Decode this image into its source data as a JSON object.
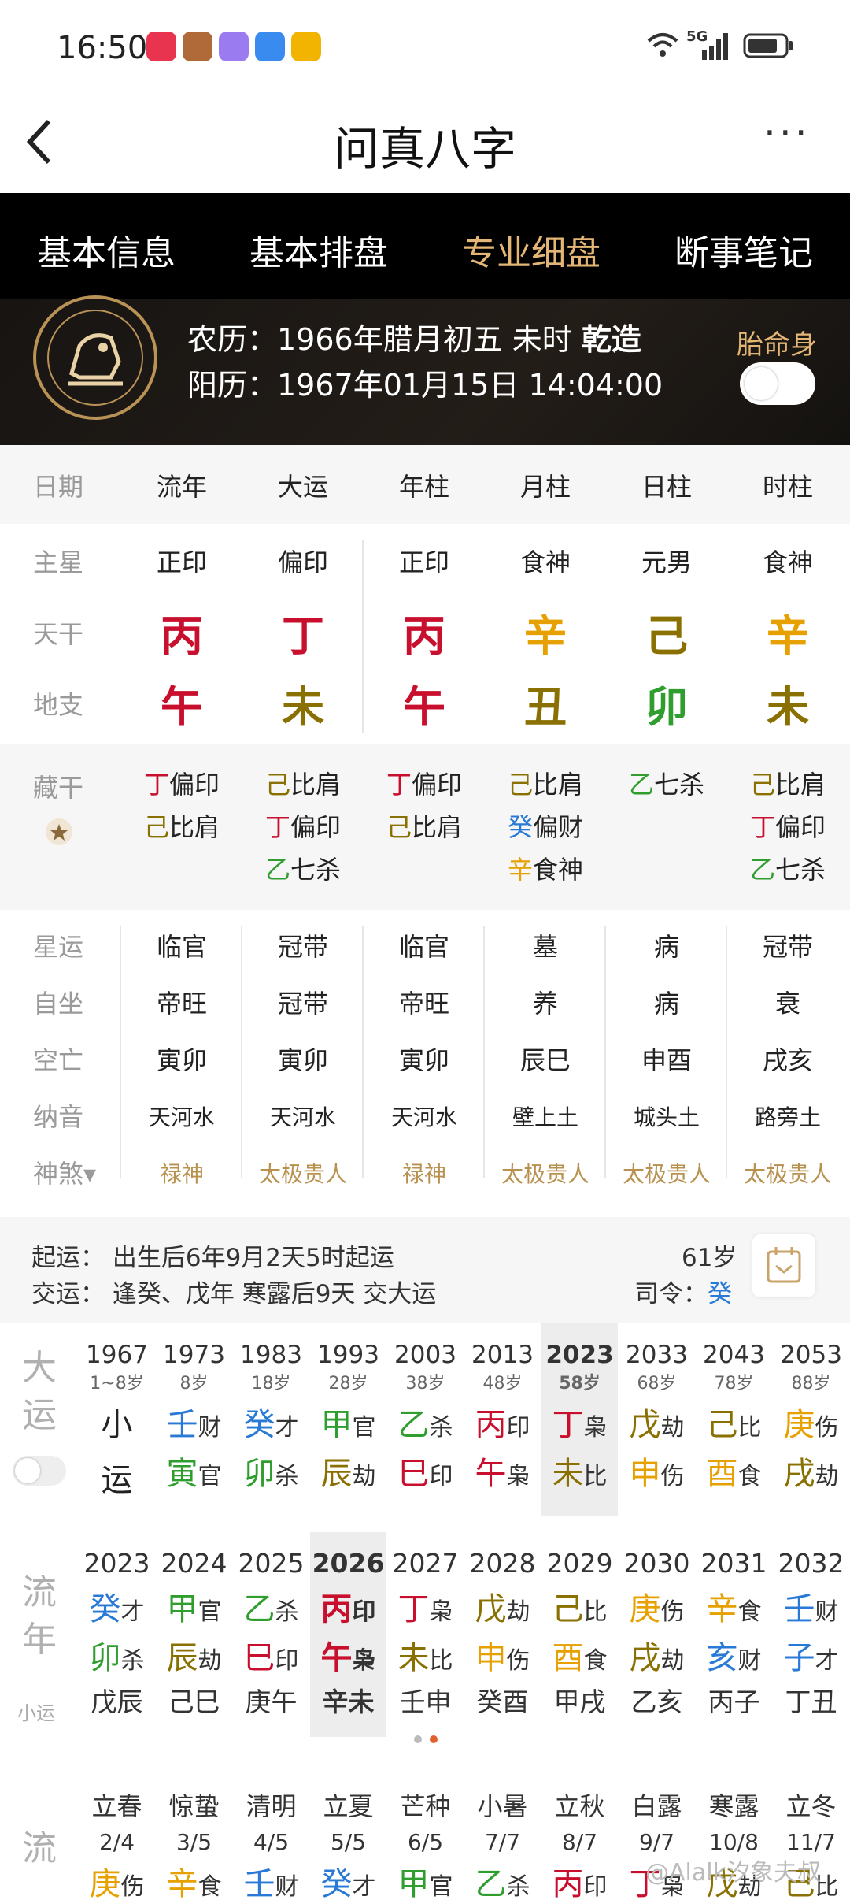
{
  "status": {
    "time": "16:50",
    "network": "5G"
  },
  "nav": {
    "back": "‹",
    "title": "问真八字",
    "more": "···"
  },
  "tabs": [
    "基本信息",
    "基本排盘",
    "专业细盘",
    "断事笔记"
  ],
  "header": {
    "lunar": "农历：1966年腊月初五 未时 ",
    "lunar_bold": "乾造",
    "solar": "阳历：1967年01月15日 14:04:00",
    "taiming": "胎命身"
  },
  "columns": [
    "日期",
    "流年",
    "大运",
    "年柱",
    "月柱",
    "日柱",
    "时柱"
  ],
  "zhuxing": {
    "label": "主星",
    "values": [
      "正印",
      "偏印",
      "正印",
      "食神",
      "元男",
      "食神"
    ]
  },
  "tiangan": {
    "label": "天干",
    "values": [
      [
        "丙",
        "#c8102e"
      ],
      [
        "丁",
        "#c8102e"
      ],
      [
        "丙",
        "#c8102e"
      ],
      [
        "辛",
        "#e6a000"
      ],
      [
        "己",
        "#8a7000"
      ],
      [
        "辛",
        "#e6a000"
      ]
    ]
  },
  "dizhi": {
    "label": "地支",
    "values": [
      [
        "午",
        "#c8102e"
      ],
      [
        "未",
        "#8a7000"
      ],
      [
        "午",
        "#c8102e"
      ],
      [
        "丑",
        "#8a7000"
      ],
      [
        "卯",
        "#2f9e2f"
      ],
      [
        "未",
        "#8a7000"
      ]
    ]
  },
  "canggan": {
    "label": "藏干",
    "cols": [
      [
        [
          "丁",
          "偏印",
          "#c8102e"
        ],
        [
          "己",
          "比肩",
          "#8a7000"
        ]
      ],
      [
        [
          "己",
          "比肩",
          "#8a7000"
        ],
        [
          "丁",
          "偏印",
          "#c8102e"
        ],
        [
          "乙",
          "七杀",
          "#2f9e2f"
        ]
      ],
      [
        [
          "丁",
          "偏印",
          "#c8102e"
        ],
        [
          "己",
          "比肩",
          "#8a7000"
        ]
      ],
      [
        [
          "己",
          "比肩",
          "#8a7000"
        ],
        [
          "癸",
          "偏财",
          "#2979d6"
        ],
        [
          "辛",
          "食神",
          "#e6a000"
        ]
      ],
      [
        [
          "乙",
          "七杀",
          "#2f9e2f"
        ]
      ],
      [
        [
          "己",
          "比肩",
          "#8a7000"
        ],
        [
          "丁",
          "偏印",
          "#c8102e"
        ],
        [
          "乙",
          "七杀",
          "#2f9e2f"
        ]
      ]
    ]
  },
  "rows": [
    {
      "label": "星运",
      "values": [
        "临官",
        "冠带",
        "临官",
        "墓",
        "病",
        "冠带"
      ]
    },
    {
      "label": "自坐",
      "values": [
        "帝旺",
        "冠带",
        "帝旺",
        "养",
        "病",
        "衰"
      ]
    },
    {
      "label": "空亡",
      "values": [
        "寅卯",
        "寅卯",
        "寅卯",
        "辰巳",
        "申酉",
        "戌亥"
      ]
    },
    {
      "label": "纳音",
      "values": [
        "天河水",
        "天河水",
        "天河水",
        "壁上土",
        "城头土",
        "路旁土"
      ]
    },
    {
      "label": "神煞▾",
      "values": [
        "禄神",
        "太极贵人",
        "禄神",
        "太极贵人",
        "太极贵人",
        "太极贵人"
      ]
    }
  ],
  "qiyun": {
    "line1": "起运：  出生后6年9月2天5时起运",
    "line2": "交运：  逢癸、戊年 寒露后9天 交大运",
    "age": "61岁",
    "siling_label": "司令：",
    "siling": "癸"
  },
  "dayun": {
    "label": [
      "大",
      "运"
    ],
    "first": {
      "year": "1967",
      "age": "1~8岁",
      "c1": "小",
      "c2": "运"
    },
    "items": [
      {
        "year": "1973",
        "age": "8岁",
        "g": "壬",
        "gs": "财",
        "gc": "#2979d6",
        "z": "寅",
        "zs": "官",
        "zc": "#2f9e2f"
      },
      {
        "year": "1983",
        "age": "18岁",
        "g": "癸",
        "gs": "才",
        "gc": "#2979d6",
        "z": "卯",
        "zs": "杀",
        "zc": "#2f9e2f"
      },
      {
        "year": "1993",
        "age": "28岁",
        "g": "甲",
        "gs": "官",
        "gc": "#2f9e2f",
        "z": "辰",
        "zs": "劫",
        "zc": "#8a7000"
      },
      {
        "year": "2003",
        "age": "38岁",
        "g": "乙",
        "gs": "杀",
        "gc": "#2f9e2f",
        "z": "巳",
        "zs": "印",
        "zc": "#c8102e"
      },
      {
        "year": "2013",
        "age": "48岁",
        "g": "丙",
        "gs": "印",
        "gc": "#c8102e",
        "z": "午",
        "zs": "枭",
        "zc": "#c8102e"
      },
      {
        "year": "2023",
        "age": "58岁",
        "g": "丁",
        "gs": "枭",
        "gc": "#c8102e",
        "z": "未",
        "zs": "比",
        "zc": "#8a7000",
        "sel": true
      },
      {
        "year": "2033",
        "age": "68岁",
        "g": "戊",
        "gs": "劫",
        "gc": "#8a7000",
        "z": "申",
        "zs": "伤",
        "zc": "#e6a000"
      },
      {
        "year": "2043",
        "age": "78岁",
        "g": "己",
        "gs": "比",
        "gc": "#8a7000",
        "z": "酉",
        "zs": "食",
        "zc": "#e6a000"
      },
      {
        "year": "2053",
        "age": "88岁",
        "g": "庚",
        "gs": "伤",
        "gc": "#e6a000",
        "z": "戌",
        "zs": "劫",
        "zc": "#8a7000"
      }
    ]
  },
  "liunian": {
    "label": [
      "流",
      "年"
    ],
    "sub": "小运",
    "items": [
      {
        "year": "2023",
        "g": "癸",
        "gs": "才",
        "gc": "#2979d6",
        "z": "卯",
        "zs": "杀",
        "zc": "#2f9e2f",
        "x": "戊辰"
      },
      {
        "year": "2024",
        "g": "甲",
        "gs": "官",
        "gc": "#2f9e2f",
        "z": "辰",
        "zs": "劫",
        "zc": "#8a7000",
        "x": "己巳"
      },
      {
        "year": "2025",
        "g": "乙",
        "gs": "杀",
        "gc": "#2f9e2f",
        "z": "巳",
        "zs": "印",
        "zc": "#c8102e",
        "x": "庚午"
      },
      {
        "year": "2026",
        "g": "丙",
        "gs": "印",
        "gc": "#c8102e",
        "z": "午",
        "zs": "枭",
        "zc": "#c8102e",
        "x": "辛未",
        "sel": true
      },
      {
        "year": "2027",
        "g": "丁",
        "gs": "枭",
        "gc": "#c8102e",
        "z": "未",
        "zs": "比",
        "zc": "#8a7000",
        "x": "壬申"
      },
      {
        "year": "2028",
        "g": "戊",
        "gs": "劫",
        "gc": "#8a7000",
        "z": "申",
        "zs": "伤",
        "zc": "#e6a000",
        "x": "癸酉"
      },
      {
        "year": "2029",
        "g": "己",
        "gs": "比",
        "gc": "#8a7000",
        "z": "酉",
        "zs": "食",
        "zc": "#e6a000",
        "x": "甲戌"
      },
      {
        "year": "2030",
        "g": "庚",
        "gs": "伤",
        "gc": "#e6a000",
        "z": "戌",
        "zs": "劫",
        "zc": "#8a7000",
        "x": "乙亥"
      },
      {
        "year": "2031",
        "g": "辛",
        "gs": "食",
        "gc": "#e6a000",
        "z": "亥",
        "zs": "财",
        "zc": "#2979d6",
        "x": "丙子"
      },
      {
        "year": "2032",
        "g": "壬",
        "gs": "财",
        "gc": "#2979d6",
        "z": "子",
        "zs": "才",
        "zc": "#2979d6",
        "x": "丁丑"
      }
    ]
  },
  "liuyue": {
    "label": "流",
    "items": [
      {
        "term": "立春",
        "date": "2/4",
        "g": "庚",
        "gs": "伤",
        "gc": "#e6a000"
      },
      {
        "term": "惊蛰",
        "date": "3/5",
        "g": "辛",
        "gs": "食",
        "gc": "#e6a000"
      },
      {
        "term": "清明",
        "date": "4/5",
        "g": "壬",
        "gs": "财",
        "gc": "#2979d6"
      },
      {
        "term": "立夏",
        "date": "5/5",
        "g": "癸",
        "gs": "才",
        "gc": "#2979d6"
      },
      {
        "term": "芒种",
        "date": "6/5",
        "g": "甲",
        "gs": "官",
        "gc": "#2f9e2f"
      },
      {
        "term": "小暑",
        "date": "7/7",
        "g": "乙",
        "gs": "杀",
        "gc": "#2f9e2f"
      },
      {
        "term": "立秋",
        "date": "8/7",
        "g": "丙",
        "gs": "印",
        "gc": "#c8102e"
      },
      {
        "term": "白露",
        "date": "9/7",
        "g": "丁",
        "gs": "枭",
        "gc": "#c8102e"
      },
      {
        "term": "寒露",
        "date": "10/8",
        "g": "戊",
        "gs": "劫",
        "gc": "#8a7000"
      },
      {
        "term": "立冬",
        "date": "11/7",
        "g": "己",
        "gs": "比",
        "gc": "#8a7000"
      }
    ]
  },
  "watermark": "@Alalk汐象夫叔"
}
